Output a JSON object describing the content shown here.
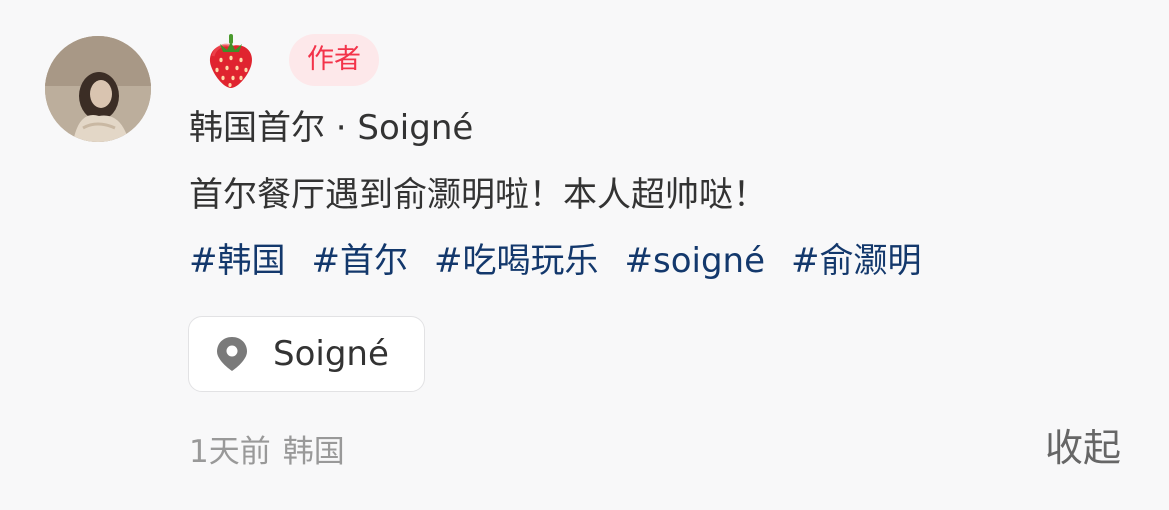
{
  "comment": {
    "author_badge": "作者",
    "title": "韩国首尔 · Soigné",
    "content": "首尔餐厅遇到俞灏明啦！本人超帅哒！",
    "tags": [
      "#韩国",
      "#首尔",
      "#吃喝玩乐",
      "#soigné",
      "#俞灏明"
    ],
    "location": "Soigné",
    "time": "1天前",
    "region": "韩国",
    "collapse_label": "收起"
  },
  "icons": {
    "author_name_emoji": "strawberry-icon",
    "location": "map-pin-icon"
  },
  "colors": {
    "background": "#f8f8f9",
    "badge_bg": "#fde8ea",
    "badge_text": "#f3334a",
    "tag_text": "#13386c",
    "meta_text": "#999999",
    "body_text": "#333333"
  }
}
